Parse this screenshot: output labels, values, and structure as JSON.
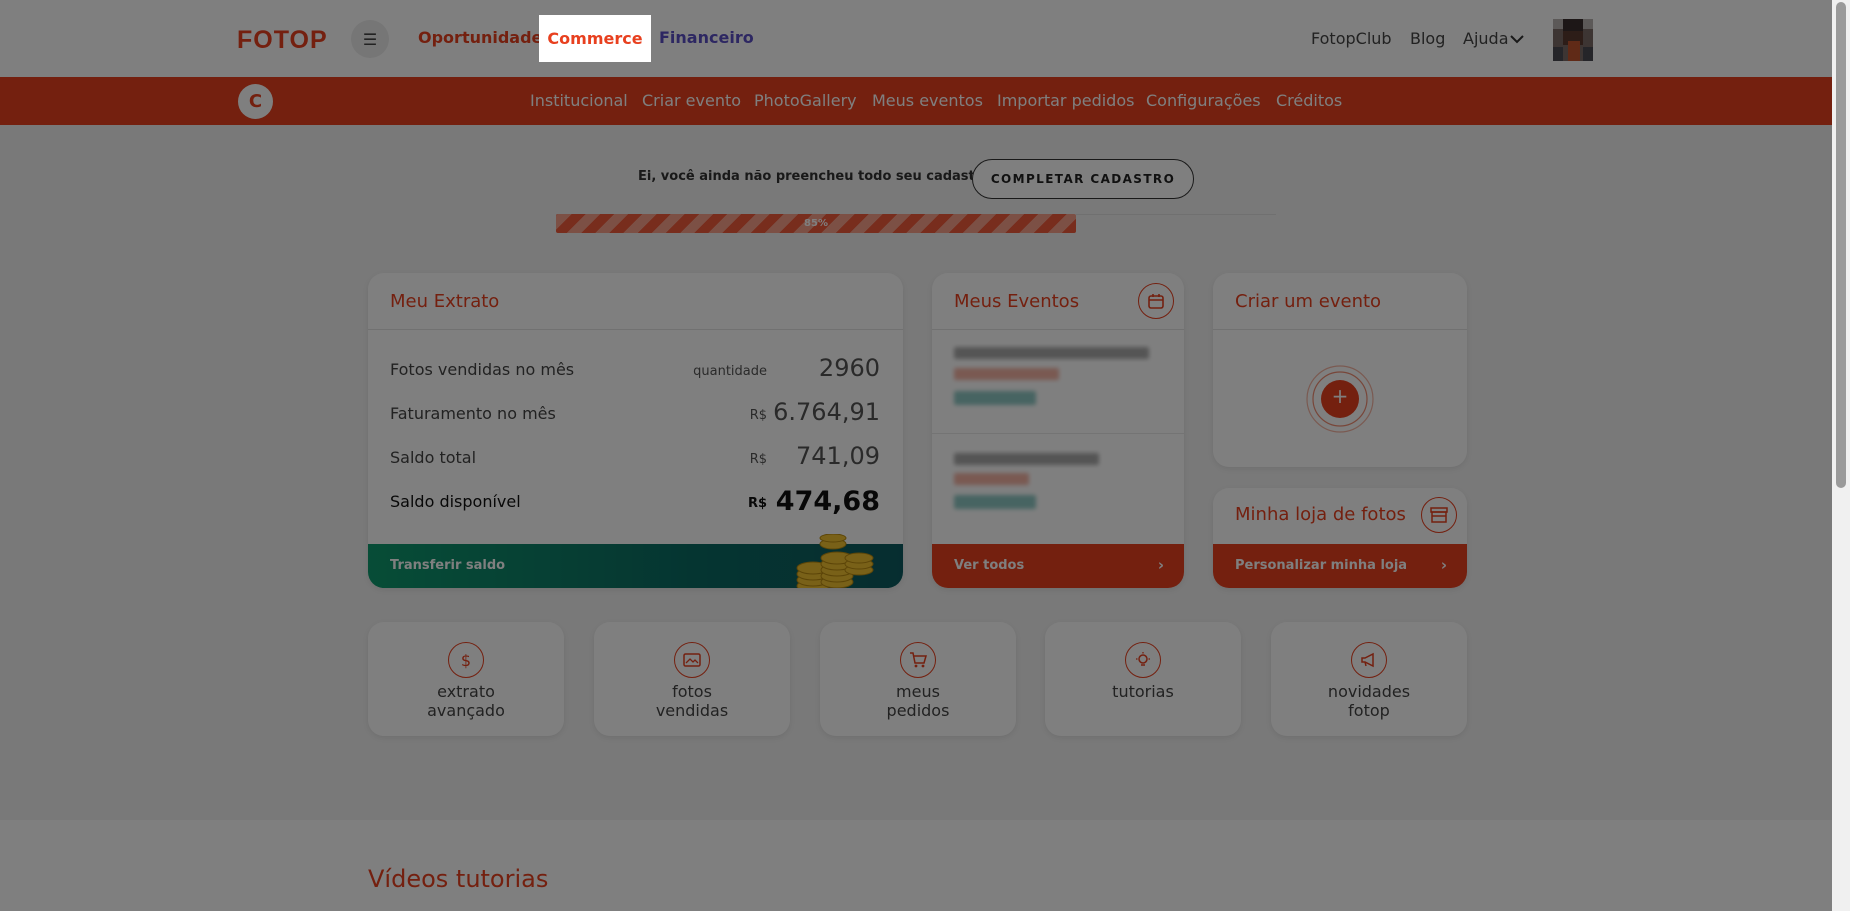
{
  "colors": {
    "accent": "#e8401f",
    "logo": "#e8401f",
    "financeiro": "#6a5acd",
    "oportunidades": "#e8401f",
    "green": "#0e9a6e"
  },
  "header": {
    "logo": "FOTOP",
    "nav": {
      "oportunidades": "Oportunidades",
      "commerce": "Commerce",
      "financeiro": "Financeiro"
    },
    "right": {
      "club": "FotopClub",
      "blog": "Blog",
      "help": "Ajuda"
    },
    "menu_icon": "menu-icon"
  },
  "subnav": {
    "avatar_letter": "C",
    "items": [
      "Institucional",
      "Criar evento",
      "PhotoGallery",
      "Meus eventos",
      "Importar pedidos",
      "Configurações",
      "Créditos"
    ]
  },
  "profile": {
    "message": "Ei, você ainda não preencheu todo seu cadastro.",
    "button": "COMPLETAR CADASTRO",
    "progress_label": "85%",
    "progress_pct": 85
  },
  "extrato": {
    "title": "Meu Extrato",
    "rows": [
      {
        "label": "Fotos vendidas no mês",
        "unit": "quantidade",
        "value": "2960"
      },
      {
        "label": "Faturamento no mês",
        "unit": "R$",
        "value": "6.764,91"
      },
      {
        "label": "Saldo total",
        "unit": "R$",
        "value": "741,09"
      },
      {
        "label": "Saldo disponível",
        "unit": "R$",
        "value": "474,68"
      }
    ],
    "transfer": "Transferir saldo"
  },
  "eventos": {
    "title": "Meus Eventos",
    "footer": "Ver todos"
  },
  "criar": {
    "title": "Criar um evento",
    "plus": "+"
  },
  "loja": {
    "title": "Minha loja de fotos",
    "footer": "Personalizar minha loja"
  },
  "tiles": [
    {
      "line1": "extrato",
      "line2": "avançado",
      "icon": "dollar-icon"
    },
    {
      "line1": "fotos",
      "line2": "vendidas",
      "icon": "photo-icon"
    },
    {
      "line1": "meus",
      "line2": "pedidos",
      "icon": "cart-icon"
    },
    {
      "line1": "tutorias",
      "line2": "",
      "icon": "lightbulb-icon"
    },
    {
      "line1": "novidades",
      "line2": "fotop",
      "icon": "megaphone-icon"
    }
  ],
  "videos": {
    "title": "Vídeos tutorias"
  }
}
